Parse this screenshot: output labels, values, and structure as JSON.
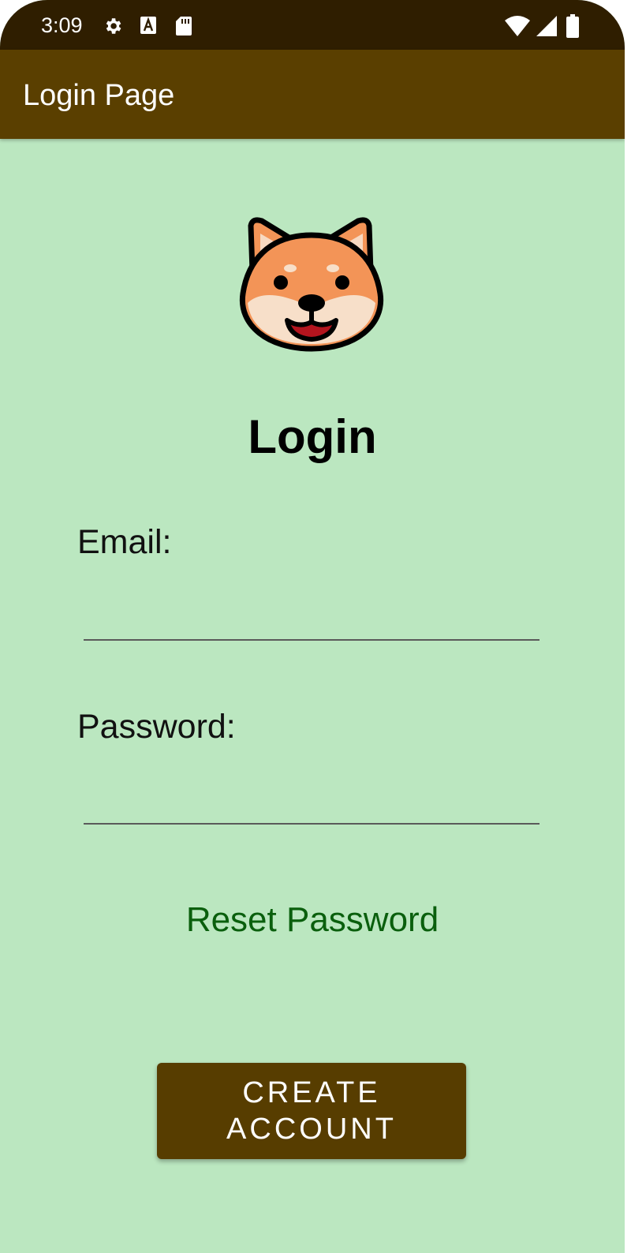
{
  "status_bar": {
    "time": "3:09",
    "left_icons": [
      "gear-icon",
      "font-a-icon",
      "sd-card-icon"
    ],
    "right_icons": [
      "wifi-icon",
      "cell-signal-icon",
      "battery-icon"
    ]
  },
  "app_bar": {
    "title": "Login Page"
  },
  "logo": {
    "icon": "shiba-dog-icon"
  },
  "form": {
    "heading": "Login",
    "email_label": "Email:",
    "email_value": "",
    "password_label": "Password:",
    "password_value": ""
  },
  "links": {
    "reset_password": "Reset Password"
  },
  "buttons": {
    "create_account": "CREATE ACCOUNT"
  },
  "colors": {
    "background": "#bbe7c0",
    "status_bar": "#2f1e00",
    "app_bar": "#5a3f00",
    "button": "#573d00",
    "link": "#0a5f0d"
  }
}
